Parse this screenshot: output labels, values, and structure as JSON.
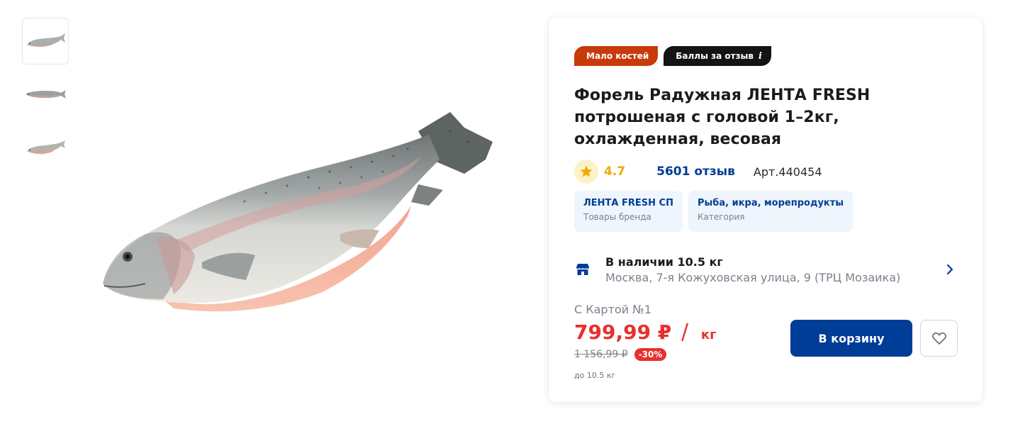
{
  "thumbnails": [
    {
      "alt": "fish-thumbnail-1",
      "active": true
    },
    {
      "alt": "fish-thumbnail-2",
      "active": false
    },
    {
      "alt": "fish-thumbnail-3",
      "active": false
    }
  ],
  "badges": {
    "few_bones": "Мало костей",
    "review_points": "Баллы за отзыв",
    "info_glyph": "i"
  },
  "product": {
    "title": "Форель Радужная ЛЕНТА FRESH потрошеная с головой 1–2кг, охлажденная, весовая",
    "rating": "4.7",
    "reviews": "5601 отзыв",
    "article": "Арт.440454"
  },
  "chips": [
    {
      "title": "ЛЕНТА FRESH СП",
      "subtitle": "Товары бренда"
    },
    {
      "title": "Рыба, икра, морепродукты",
      "subtitle": "Категория"
    }
  ],
  "stock": {
    "title": "В наличии 10.5 кг",
    "address": "Москва, 7-я Кожуховская улица, 9 (ТРЦ Мозаика)"
  },
  "pricing": {
    "card_label": "С Картой №1",
    "price": "799,99 ₽",
    "slash": "/",
    "unit": "кг",
    "old_price": "1 156,99 ₽",
    "discount": "-30%",
    "limit": "до 10.5 кг"
  },
  "actions": {
    "cart_label": "В корзину"
  },
  "icons": {
    "rating": "star-icon",
    "store": "store-icon",
    "navigate": "chevron-right-icon",
    "favorite": "heart-icon"
  },
  "colors": {
    "primary": "#003d96",
    "price_red": "#e8302f",
    "badge_red": "#c73a0c",
    "badge_dark": "#141414",
    "star": "#f2a900",
    "chip_bg": "#eef5fd"
  }
}
